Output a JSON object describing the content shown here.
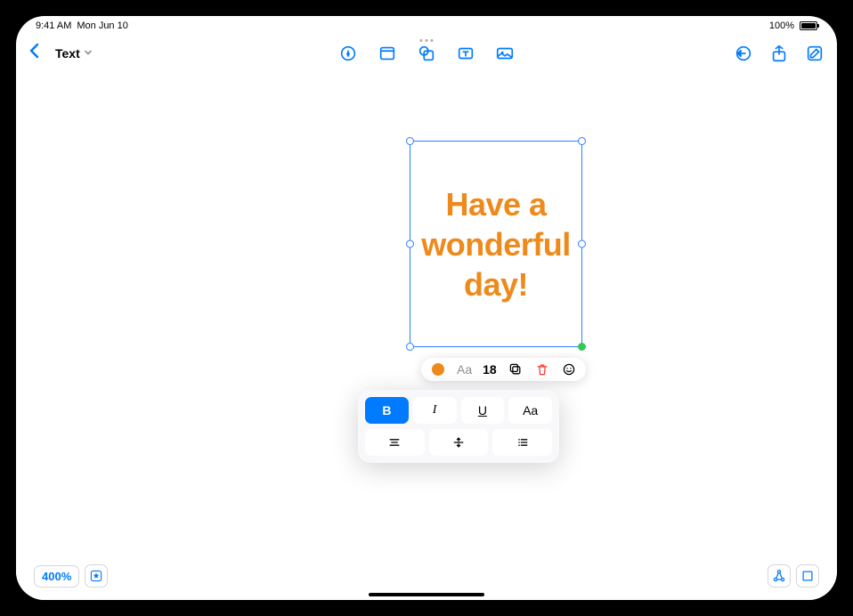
{
  "status": {
    "time": "9:41 AM",
    "date": "Mon Jun 10",
    "battery": "100%"
  },
  "header": {
    "title": "Text"
  },
  "textbox": {
    "content": "Have a wonderful day!",
    "color": "#ee8a1b"
  },
  "format_pill": {
    "font_label": "Aa",
    "font_size": "18"
  },
  "style_panel": {
    "bold": "B",
    "italic": "I",
    "underline": "U",
    "case": "Aa"
  },
  "bottom": {
    "zoom": "400%"
  }
}
